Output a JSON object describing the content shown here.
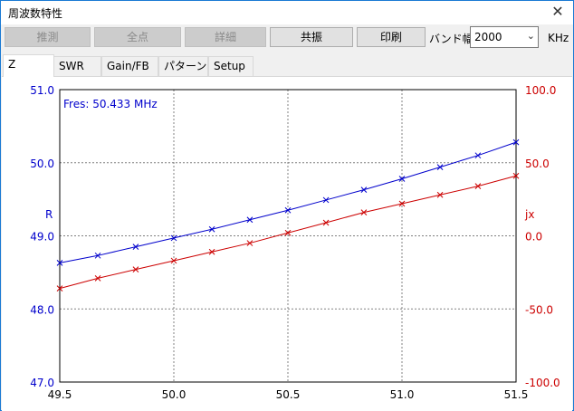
{
  "window": {
    "title": "周波数特性",
    "close_glyph": "✕"
  },
  "toolbar": {
    "buttons": [
      {
        "label": "推測",
        "enabled": false
      },
      {
        "label": "全点",
        "enabled": false
      },
      {
        "label": "詳細",
        "enabled": false
      },
      {
        "label": "共振",
        "enabled": true
      },
      {
        "label": "印刷",
        "enabled": true
      }
    ],
    "band_label": "バンド幅",
    "band_value": "2000",
    "band_unit": "KHz"
  },
  "tabs": [
    {
      "label": "Z",
      "active": true
    },
    {
      "label": "SWR",
      "active": false
    },
    {
      "label": "Gain/FB",
      "active": false
    },
    {
      "label": "パターン",
      "active": false
    },
    {
      "label": "Setup",
      "active": false
    }
  ],
  "chart_data": {
    "type": "line",
    "annotation": "Fres: 50.433 MHz",
    "left_axis_label": "R",
    "right_axis_label": "jx",
    "xlim": [
      49.5,
      51.5
    ],
    "x_ticks": [
      "49.5",
      "50.0",
      "50.5",
      "51.0",
      "51.5"
    ],
    "left_ylim": [
      47.0,
      51.0
    ],
    "left_ticks": [
      "47.0",
      "48.0",
      "49.0",
      "50.0",
      "51.0"
    ],
    "right_ylim": [
      -100.0,
      100.0
    ],
    "right_ticks": [
      "-100.0",
      "-50.0",
      "0.0",
      "50.0",
      "100.0"
    ],
    "grid": true,
    "colors": {
      "R": "#0000cc",
      "jx": "#cc0000",
      "axis_left": "#0000cc",
      "axis_right": "#cc0000"
    },
    "x": [
      49.5,
      49.667,
      49.833,
      50.0,
      50.167,
      50.333,
      50.5,
      50.667,
      50.833,
      51.0,
      51.167,
      51.333,
      51.5
    ],
    "series": [
      {
        "name": "R",
        "axis": "left",
        "values": [
          48.63,
          48.73,
          48.85,
          48.97,
          49.09,
          49.22,
          49.35,
          49.49,
          49.63,
          49.78,
          49.94,
          50.1,
          50.28
        ]
      },
      {
        "name": "jx",
        "axis": "right",
        "values": [
          -36.0,
          -29.0,
          -23.0,
          -17.0,
          -11.0,
          -5.0,
          2.0,
          9.0,
          16.0,
          22.0,
          28.0,
          34.0,
          41.0
        ]
      }
    ]
  }
}
